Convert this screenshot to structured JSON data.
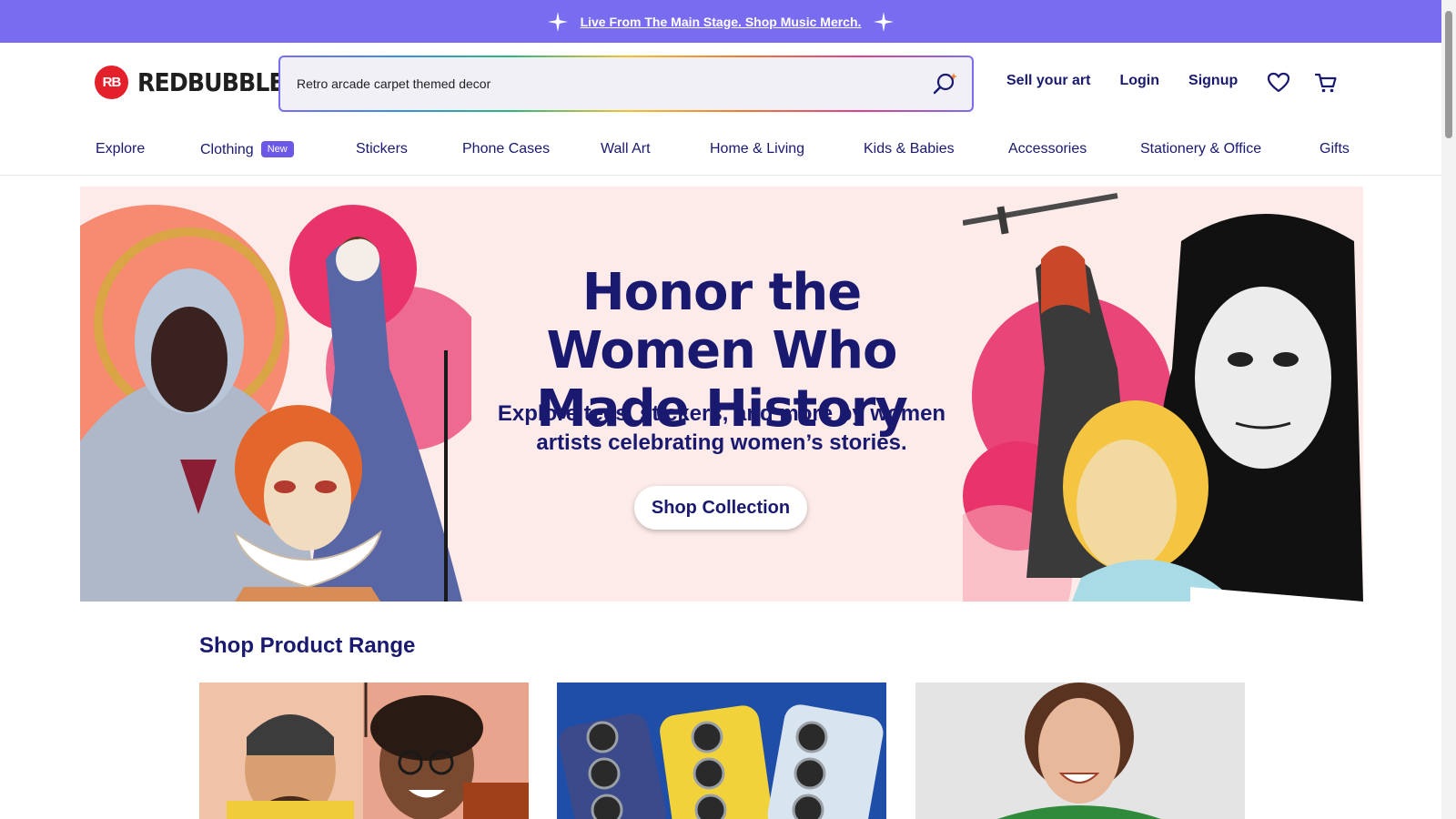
{
  "promo": {
    "text": "Live From The Main Stage. Shop Music Merch."
  },
  "header": {
    "logo_mark": "RB",
    "logo_text": "REDBUBBLE",
    "search_value": "Retro arcade carpet themed decor",
    "links": {
      "sell": "Sell your art",
      "login": "Login",
      "signup": "Signup"
    },
    "icons": {
      "search": "search-icon",
      "wishlist": "heart-icon",
      "cart": "cart-icon"
    }
  },
  "nav": {
    "items": [
      "Explore",
      "Clothing",
      "Stickers",
      "Phone Cases",
      "Wall Art",
      "Home & Living",
      "Kids & Babies",
      "Accessories",
      "Stationery & Office",
      "Gifts"
    ],
    "clothing_badge": "New"
  },
  "hero": {
    "title": "Honor the Women Who Made History",
    "subtitle": "Explore tees, stickers, and more by women artists celebrating women’s stories.",
    "button": "Shop Collection"
  },
  "product_range": {
    "title": "Shop Product Range"
  },
  "colors": {
    "accent": "#7a6cf0",
    "navy": "#191970",
    "brand_red": "#e4202a",
    "hero_bg": "#fcebe9"
  }
}
